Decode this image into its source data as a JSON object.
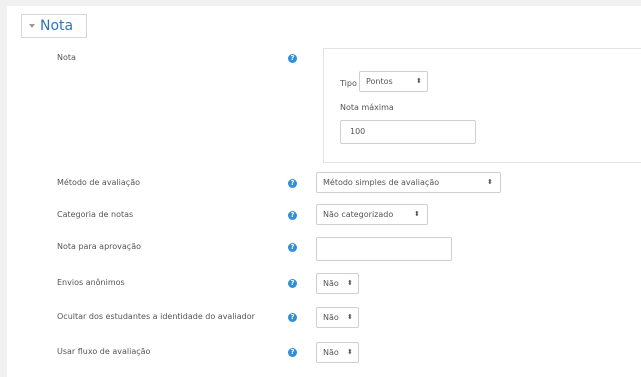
{
  "section": {
    "title": "Nota"
  },
  "grade": {
    "label": "Nota",
    "type_label": "Tipo",
    "type_value": "Pontos",
    "max_label": "Nota máxima",
    "max_value": "100"
  },
  "rows": [
    {
      "label": "Método de avaliação",
      "value": "Método simples de avaliação"
    },
    {
      "label": "Categoria de notas",
      "value": "Não categorizado"
    },
    {
      "label": "Nota para aprovação",
      "value": ""
    },
    {
      "label": "Envios anônimos",
      "value": "Não"
    },
    {
      "label": "Ocultar dos estudantes a identidade do avaliador",
      "value": "Não"
    },
    {
      "label": "Usar fluxo de avaliação",
      "value": "Não"
    }
  ],
  "help_glyph": "?",
  "select_arrow": "⬍",
  "colors": {
    "accent": "#2e76b5",
    "help_icon": "#2f8fd8"
  }
}
